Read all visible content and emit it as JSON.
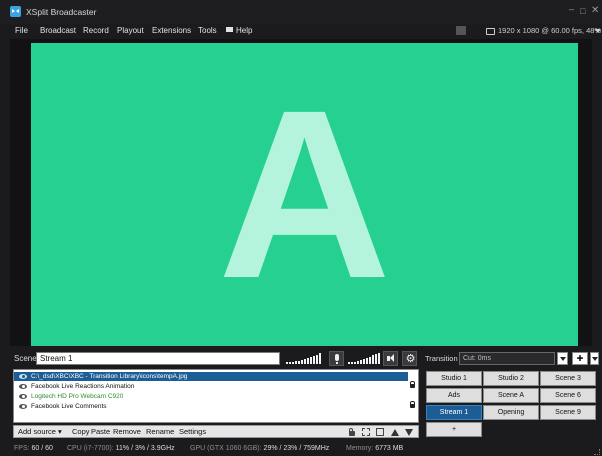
{
  "app": {
    "title": "XSplit Broadcaster"
  },
  "window_controls": {
    "minimize": "–",
    "maximize": "□",
    "close": "✕"
  },
  "menu": [
    "File",
    "Broadcast",
    "Record",
    "Playout",
    "Extensions",
    "Tools",
    "Help"
  ],
  "header_right": {
    "resolution": "1920 x 1080 @ 60.00 fps, 48%"
  },
  "preview": {
    "letter": "A",
    "background_color": "#26d091",
    "letter_color": "#b5f4dc"
  },
  "scene": {
    "label": "Scene",
    "name": "Stream 1"
  },
  "icons": {
    "mic": "microphone-icon",
    "speaker": "speaker-icon",
    "settings": "gear-icon",
    "settings_glyph": "⚙",
    "add_transition_glyph": "✚"
  },
  "sources": [
    {
      "label": "C:\\_dsd\\XBC\\XBC - Transition Library\\icons\\tempA.jpg",
      "selected": true,
      "locked": false
    },
    {
      "label": "Facebook Live Reactions Animation",
      "selected": false,
      "locked": true
    },
    {
      "label": "Logitech HD Pro Webcam C920",
      "selected": false,
      "locked": false,
      "color": "#2f8a2f"
    },
    {
      "label": "Facebook Live Comments",
      "selected": false,
      "locked": true
    }
  ],
  "source_toolbar": {
    "add_source": "Add source ▾",
    "copy": "Copy",
    "paste": "Paste",
    "remove": "Remove",
    "rename": "Rename",
    "settings": "Settings"
  },
  "transition": {
    "label": "Transition",
    "value": "Cut: 0ms"
  },
  "scenes": [
    {
      "label": "Studio 1",
      "active": false
    },
    {
      "label": "Studio 2",
      "active": false
    },
    {
      "label": "Scene 3",
      "active": false
    },
    {
      "label": "Ads",
      "active": false
    },
    {
      "label": "Scene A",
      "active": false
    },
    {
      "label": "Scene 6",
      "active": false
    },
    {
      "label": "Stream 1",
      "active": true
    },
    {
      "label": "Opening",
      "active": false
    },
    {
      "label": "Scene 9",
      "active": false
    },
    {
      "label": "+",
      "active": false
    }
  ],
  "status": {
    "fps_label": "FPS:",
    "fps_value": "60 / 60",
    "cpu_label": "CPU (i7-7700):",
    "cpu_value": "11% / 3% / 3.9GHz",
    "gpu_label": "GPU (GTX 1060 6GB):",
    "gpu_value": "29% / 23% / 759MHz",
    "memory_label": "Memory:",
    "memory_value": "6773 MB"
  },
  "colors": {
    "accent": "#1c5d96",
    "preview_bg": "#26d091",
    "webcam_text": "#2f8a2f"
  }
}
